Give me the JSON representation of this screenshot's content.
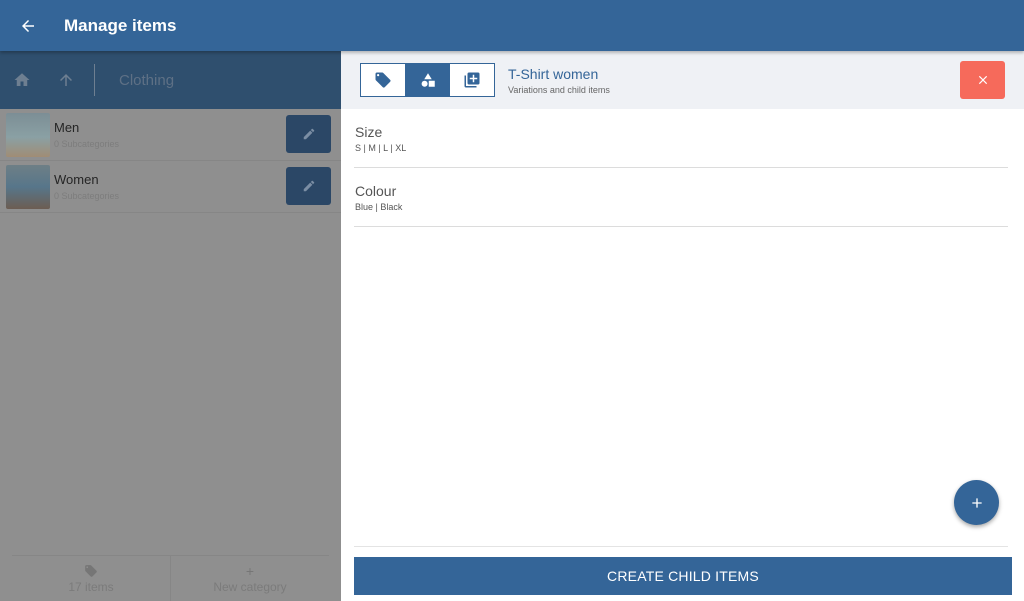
{
  "appbar": {
    "title": "Manage items",
    "back_icon": "arrow-left-icon"
  },
  "left_panel": {
    "breadcrumb": {
      "current": "Clothing"
    },
    "categories": [
      {
        "name": "Men",
        "sub": "0 Subcategories"
      },
      {
        "name": "Women",
        "sub": "0 Subcategories"
      }
    ],
    "footer": {
      "items_label": "17 items",
      "new_category_label": "New category"
    }
  },
  "detail": {
    "title": "T-Shirt women",
    "subtitle": "Variations and child items",
    "tabs": [
      "tag-icon",
      "shapes-icon",
      "add-library-icon"
    ],
    "active_tab": 1,
    "variations": [
      {
        "name": "Size",
        "values": "S | M | L | XL"
      },
      {
        "name": "Colour",
        "values": "Blue | Black"
      }
    ],
    "create_button": "CREATE CHILD ITEMS"
  },
  "colors": {
    "primary": "#346598",
    "danger": "#f66a5b",
    "overlay": "#8f8f8f"
  }
}
